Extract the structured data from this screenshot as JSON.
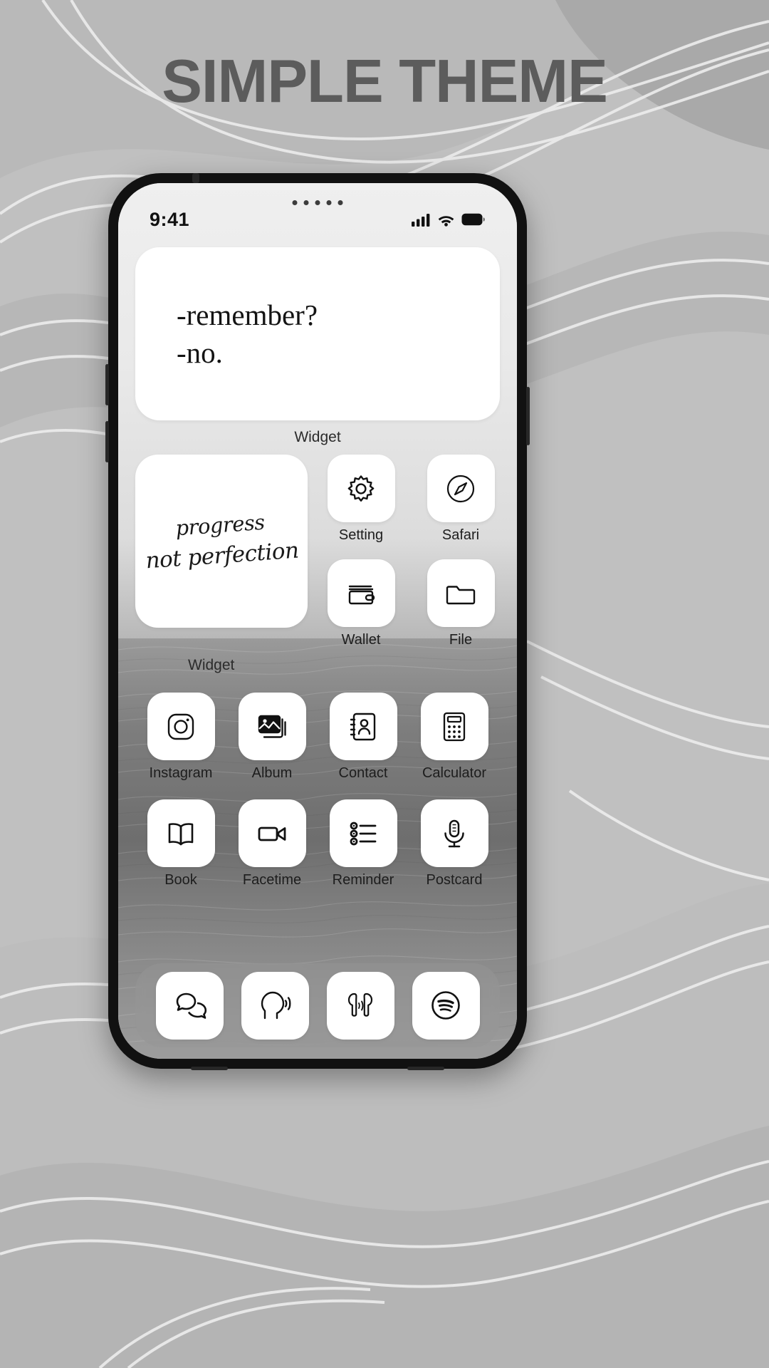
{
  "headline": "SIMPLE THEME",
  "theme": {
    "accent": "#5c5c5c",
    "background": "#c0c0c0",
    "tile_bg": "#ffffff",
    "icon_stroke": "#111111"
  },
  "statusbar": {
    "time": "9:41",
    "cellular_icon": "signal-bars-icon",
    "wifi_icon": "wifi-icon",
    "battery_icon": "battery-icon",
    "speaker_dots": 5
  },
  "widgets": {
    "quote": {
      "line1": "-remember?",
      "line2": "-no.",
      "caption": "Widget"
    },
    "script": {
      "line1": "progress",
      "line2": "not perfection",
      "caption": "Widget"
    }
  },
  "apps_top": [
    {
      "label": "Setting",
      "icon": "gear-icon"
    },
    {
      "label": "Safari",
      "icon": "compass-icon"
    },
    {
      "label": "Wallet",
      "icon": "wallet-icon"
    },
    {
      "label": "File",
      "icon": "folder-icon"
    }
  ],
  "apps_grid": [
    {
      "label": "Instagram",
      "icon": "instagram-icon"
    },
    {
      "label": "Album",
      "icon": "photos-icon"
    },
    {
      "label": "Contact",
      "icon": "contacts-icon"
    },
    {
      "label": "Calculator",
      "icon": "calculator-icon"
    },
    {
      "label": "Book",
      "icon": "book-icon"
    },
    {
      "label": "Facetime",
      "icon": "video-camera-icon"
    },
    {
      "label": "Reminder",
      "icon": "checklist-icon"
    },
    {
      "label": "Postcard",
      "icon": "microphone-icon"
    }
  ],
  "dock": [
    {
      "label": "Messages",
      "icon": "chat-bubbles-icon"
    },
    {
      "label": "Voice",
      "icon": "head-speaking-icon"
    },
    {
      "label": "Airpods",
      "icon": "airpods-icon"
    },
    {
      "label": "Spotify",
      "icon": "spotify-icon"
    }
  ]
}
